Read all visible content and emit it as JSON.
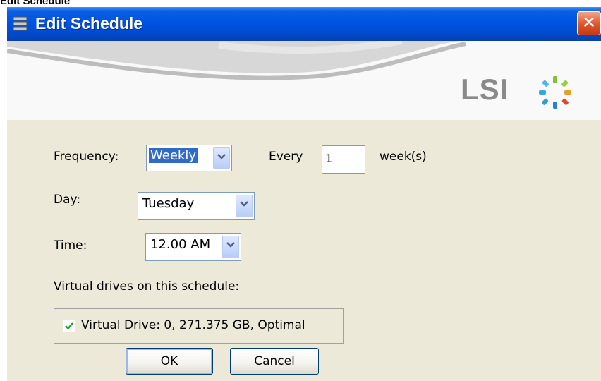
{
  "top_label": "Edit Schedule",
  "window": {
    "title": "Edit Schedule",
    "close_glyph": "✕",
    "logo_text": "LSI"
  },
  "form": {
    "frequency_label": "Frequency:",
    "frequency_value": "Weekly",
    "every_label": "Every",
    "every_value": "1",
    "week_unit": "week(s)",
    "day_label": "Day:",
    "day_value": "Tuesday",
    "time_label": "Time:",
    "time_value": "12.00 AM",
    "vd_heading": "Virtual drives on this schedule:",
    "vd_item": "Virtual Drive: 0, 271.375 GB, Optimal",
    "vd_checked": true
  },
  "buttons": {
    "ok": "OK",
    "cancel": "Cancel"
  },
  "colors": {
    "titlebar": "#0055e5",
    "dialog_bg": "#ece9d8",
    "selection": "#316ac5"
  }
}
